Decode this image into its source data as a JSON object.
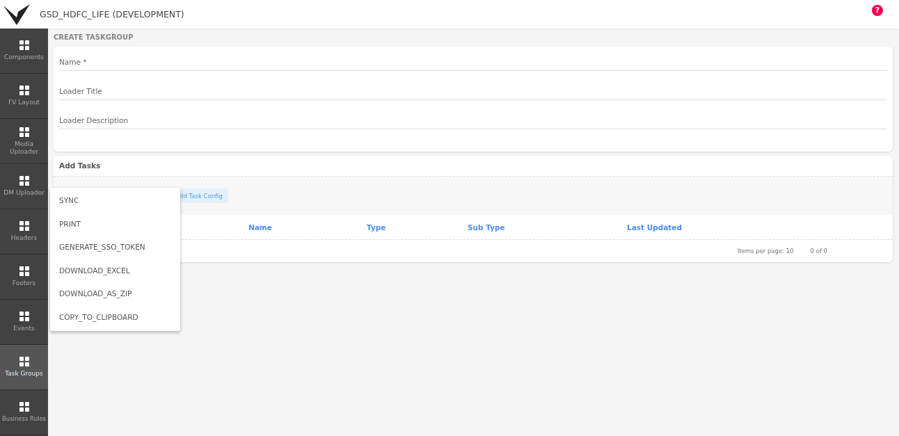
{
  "header": {
    "title": "GSD_HDFC_LIFE (DEVELOPMENT)",
    "help": "?"
  },
  "sidebar": {
    "items": [
      {
        "label": "Components",
        "selected": false
      },
      {
        "label": "FV Layout",
        "selected": false
      },
      {
        "label": "Media Uploader",
        "selected": false
      },
      {
        "label": "DM Uploader",
        "selected": false
      },
      {
        "label": "Headers",
        "selected": false
      },
      {
        "label": "Footers",
        "selected": false
      },
      {
        "label": "Events",
        "selected": false
      },
      {
        "label": "Task Groups",
        "selected": true
      },
      {
        "label": "Business Rules",
        "selected": false
      }
    ]
  },
  "page_title": "CREATE TASKGROUP",
  "form": {
    "fields": [
      {
        "placeholder": "Name *"
      },
      {
        "placeholder": "Loader Title"
      },
      {
        "placeholder": "Loader Description"
      }
    ]
  },
  "tasks": {
    "title": "Add Tasks",
    "add_button": "dd Task Config",
    "columns": [
      "Name",
      "Type",
      "Sub Type",
      "Last Updated"
    ],
    "paginator": {
      "items_per_page": "Items per page: 10",
      "range": "0 of 0"
    }
  },
  "dropdown": {
    "options": [
      "SYNC",
      "PRINT",
      "GENERATE_SSO_TOKEN",
      "DOWNLOAD_EXCEL",
      "DOWNLOAD_AS_ZIP",
      "COPY_TO_CLIPBOARD"
    ]
  }
}
